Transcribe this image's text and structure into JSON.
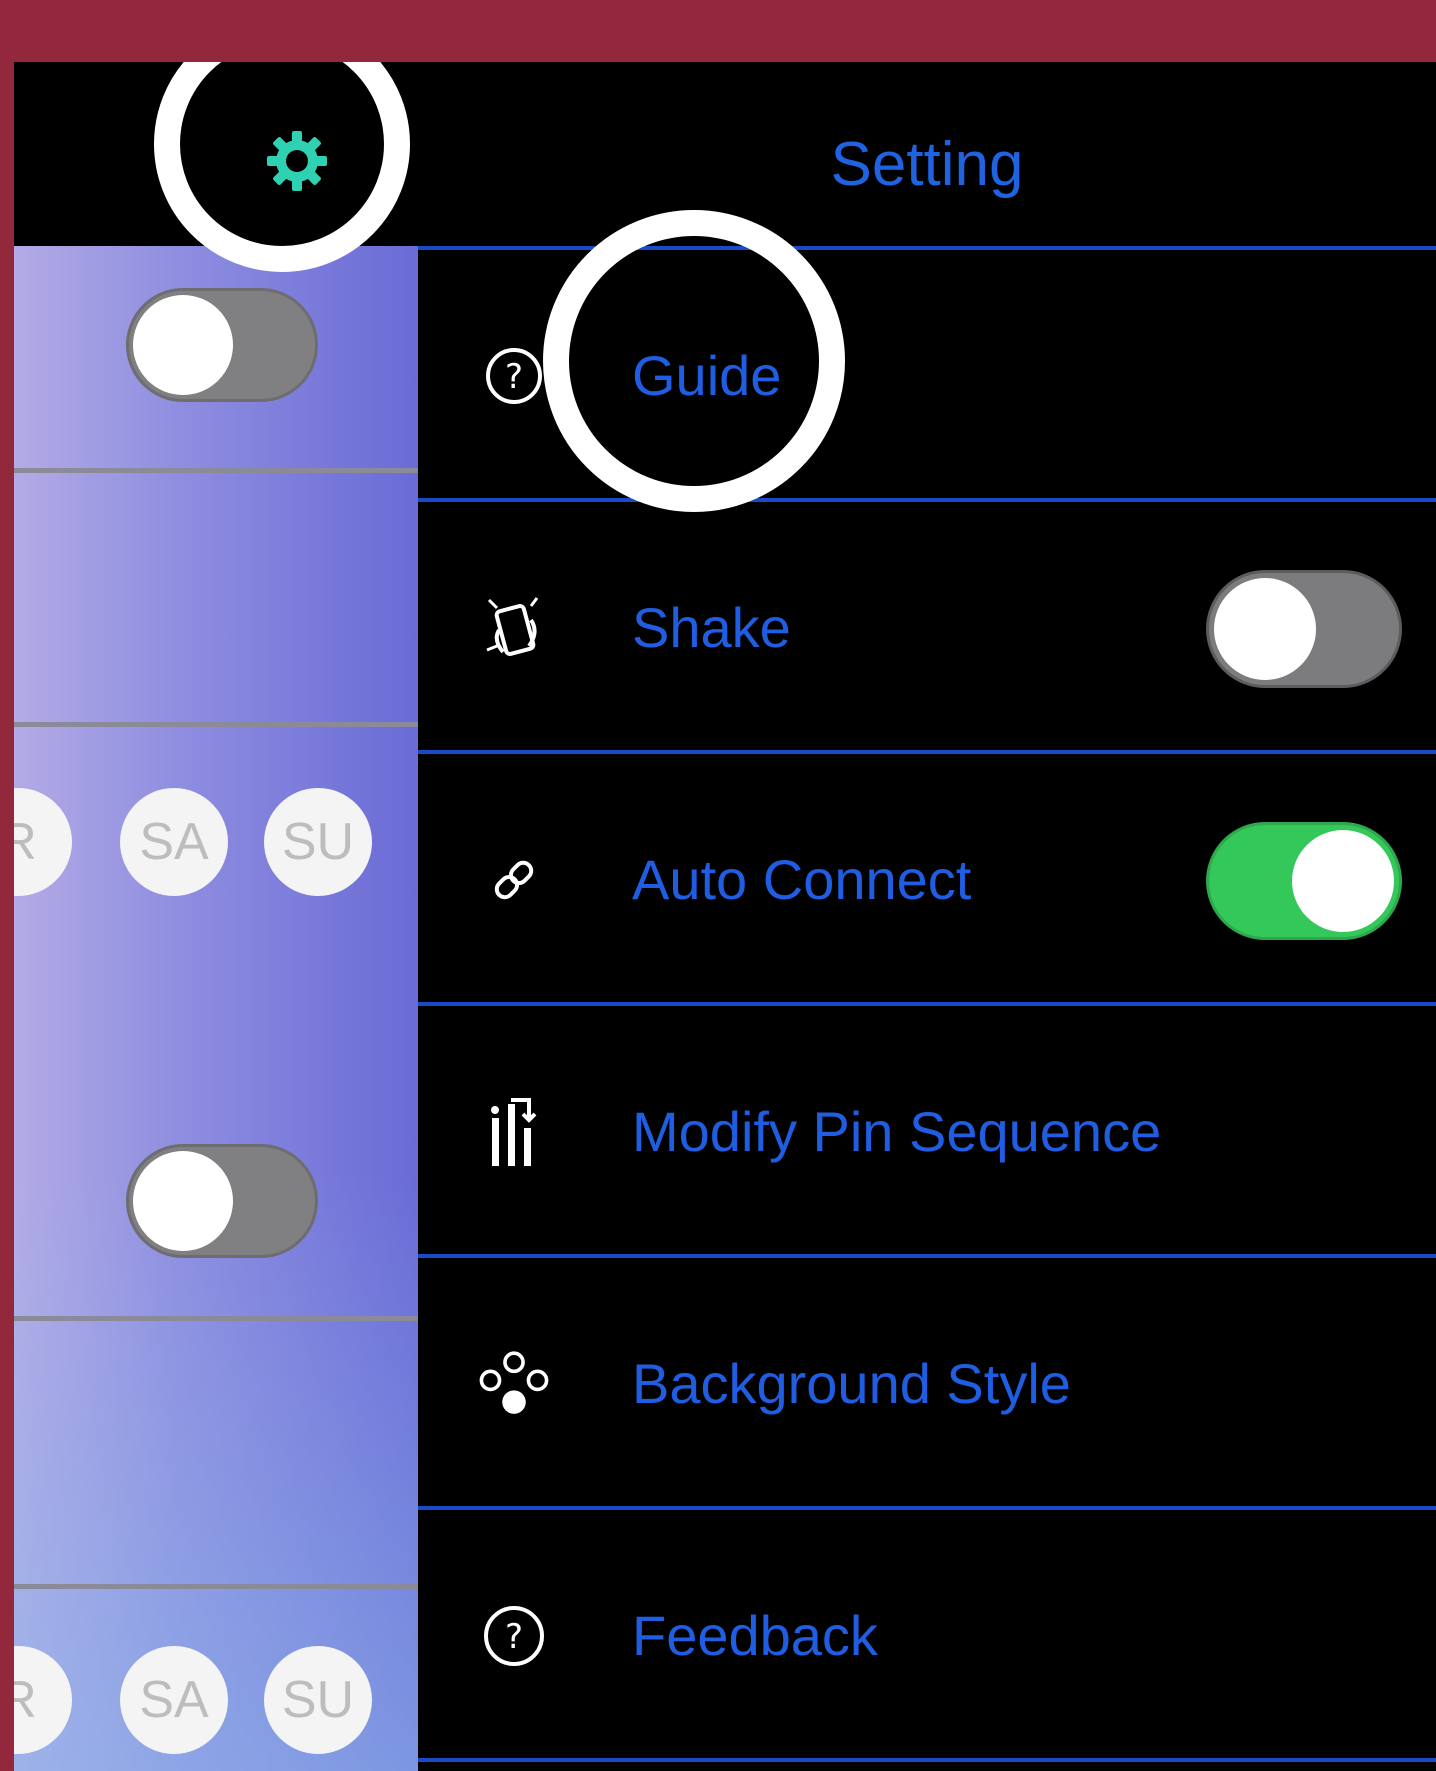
{
  "header": {
    "title": "Setting",
    "settings_icon": "gear-icon",
    "settings_icon_color": "#2fd1b3"
  },
  "settings": {
    "items": [
      {
        "label": "Guide",
        "icon": "help-circle-icon"
      },
      {
        "label": "Shake",
        "icon": "shake-phone-icon",
        "toggle": "off"
      },
      {
        "label": "Auto Connect",
        "icon": "link-icon",
        "toggle": "on"
      },
      {
        "label": "Modify Pin Sequence",
        "icon": "sequence-icon"
      },
      {
        "label": "Background Style",
        "icon": "circles-icon"
      },
      {
        "label": "Feedback",
        "icon": "help-circle-icon"
      }
    ]
  },
  "background_pane": {
    "days_row_1": [
      "R",
      "SA",
      "SU"
    ],
    "days_row_2": [
      "R",
      "SA",
      "SU"
    ],
    "toggles": [
      "off",
      "off"
    ]
  },
  "annotations": {
    "highlights": [
      "gear-icon",
      "Guide"
    ],
    "highlight_color": "#ffffff"
  },
  "colors": {
    "frame": "#93283c",
    "accent": "#1f5ee2",
    "divider": "#1a49c9",
    "toggle_on": "#34c759",
    "toggle_off": "#7c7c7e"
  }
}
